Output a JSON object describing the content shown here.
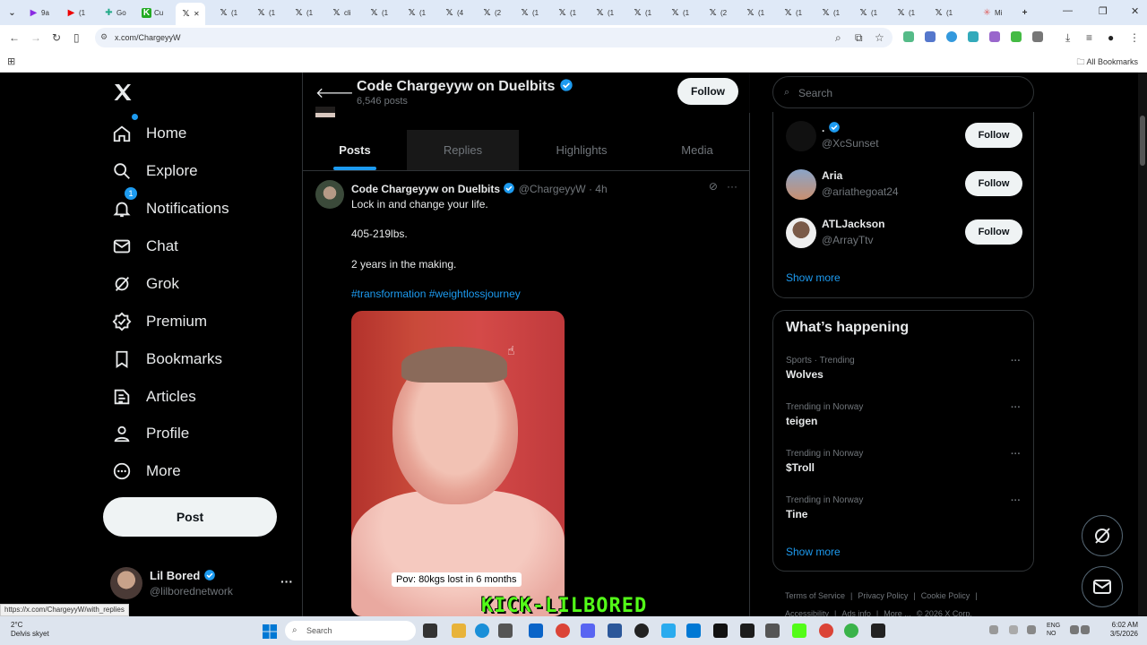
{
  "browser": {
    "tabs": [
      "9a",
      "(1",
      "Go",
      "Cu",
      "",
      "(1",
      "(1",
      "(1",
      "cli",
      "(1",
      "(1",
      "(4",
      "(2",
      "(1",
      "(1",
      "(1",
      "(1",
      "(1",
      "(2",
      "(1",
      "(1",
      "(1",
      "(1",
      "(1",
      "(1",
      "Mi"
    ],
    "url": "x.com/ChargeyyW",
    "all_bookmarks": "All Bookmarks",
    "status_url": "https://x.com/ChargeyyW/with_replies"
  },
  "nav": {
    "items": [
      {
        "label": "Home",
        "icon": "home-icon"
      },
      {
        "label": "Explore",
        "icon": "search-icon"
      },
      {
        "label": "Notifications",
        "icon": "bell-icon",
        "badge": "1"
      },
      {
        "label": "Chat",
        "icon": "mail-icon"
      },
      {
        "label": "Grok",
        "icon": "grok-icon"
      },
      {
        "label": "Premium",
        "icon": "premium-icon"
      },
      {
        "label": "Bookmarks",
        "icon": "bookmark-icon"
      },
      {
        "label": "Articles",
        "icon": "articles-icon"
      },
      {
        "label": "Profile",
        "icon": "person-icon"
      },
      {
        "label": "More",
        "icon": "more-circle-icon"
      }
    ],
    "post_label": "Post",
    "account": {
      "name": "Lil Bored",
      "handle": "@lilborednetwork"
    }
  },
  "profile": {
    "title": "Code Chargeyyw on Duelbits",
    "posts_count": "6,546 posts",
    "follow_label": "Follow",
    "tabs": [
      "Posts",
      "Replies",
      "Highlights",
      "Media"
    ],
    "selected_tab": "Posts"
  },
  "tweet": {
    "name": "Code Chargeyyw on Duelbits",
    "handle": "@ChargeyyW",
    "time": "4h",
    "lines": [
      "Lock in and change your life.",
      "405-219lbs.",
      "2 years in the making."
    ],
    "hashtags": "#transformation #weightlossjourney",
    "media_caption": "Pov: 80kgs lost in 6 months"
  },
  "overlay": {
    "stream_tag": "KICK-LILBORED"
  },
  "sidebar": {
    "search_placeholder": "Search",
    "who_to_follow": [
      {
        "name": ".",
        "handle": "@XcSunset",
        "verified": true,
        "follow": "Follow"
      },
      {
        "name": "Aria",
        "handle": "@ariathegoat24",
        "verified": false,
        "follow": "Follow"
      },
      {
        "name": "ATLJackson",
        "handle": "@ArrayTtv",
        "verified": false,
        "follow": "Follow"
      }
    ],
    "show_more": "Show more",
    "whats_happening_title": "What’s happening",
    "trends": [
      {
        "context": "Sports · Trending",
        "title": "Wolves"
      },
      {
        "context": "Trending in Norway",
        "title": "teigen"
      },
      {
        "context": "Trending in Norway",
        "title": "$Troll"
      },
      {
        "context": "Trending in Norway",
        "title": "Tine"
      }
    ],
    "footer": [
      "Terms of Service",
      "|",
      "Privacy Policy",
      "|",
      "Cookie Policy",
      "|",
      "Accessibility",
      "|",
      "Ads info",
      "|",
      "More ...",
      "© 2026 X Corp."
    ]
  },
  "taskbar": {
    "weather_temp": "2°C",
    "weather_desc": "Delvis skyet",
    "search_placeholder": "Search",
    "lang": "ENG",
    "lang_sub": "NO",
    "time": "6:02 AM",
    "date": "3/5/2026"
  },
  "colors": {
    "accent": "#1d9bf0",
    "background": "#000000",
    "kick_green": "#53fc18"
  }
}
